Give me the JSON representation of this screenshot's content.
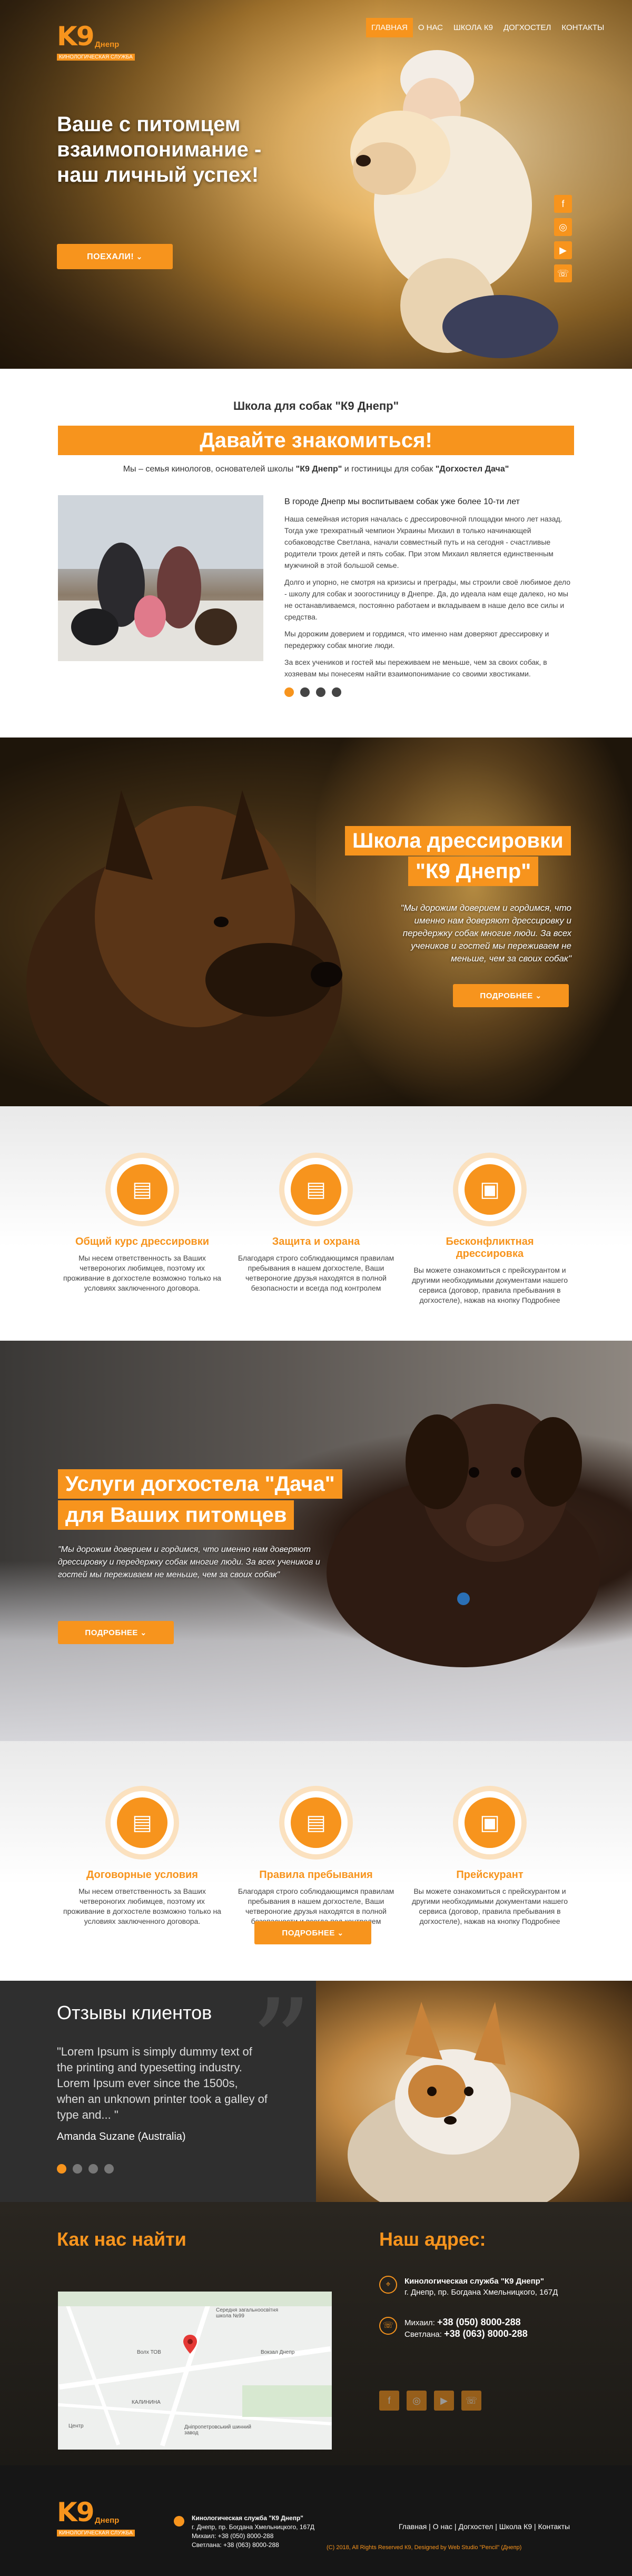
{
  "header": {
    "logo": {
      "mark": "K9",
      "name": "Днепр",
      "sub": "КИНОЛОГИЧЕСКАЯ СЛУЖБА"
    },
    "nav": [
      {
        "label": "Главная",
        "active": true
      },
      {
        "label": "О нас",
        "active": false
      },
      {
        "label": "Школа К9",
        "active": false
      },
      {
        "label": "Догхостел",
        "active": false
      },
      {
        "label": "Контакты",
        "active": false
      }
    ]
  },
  "hero": {
    "title": "Ваше с питомцем взаимопонимание - наш личный успех!",
    "button": "Поехали!",
    "social": [
      "facebook-icon",
      "instagram-icon",
      "youtube-icon",
      "viber-icon"
    ]
  },
  "about": {
    "kicker": "Школа для собак \"К9 Днепр\"",
    "banner": "Давайте знакомиться!",
    "intro_before": "Мы – семья кинологов, основателей школы ",
    "intro_school": "\"К9 Днепр\"",
    "intro_middle": " и гостиницы для собак ",
    "intro_hostel": "\"Догхостел Дача\"",
    "lead": "В городе Днепр мы воспитываем собак уже более 10-ти лет",
    "p1": "Наша семейная история началась с дрессировочной площадки много лет назад. Тогда уже трехкратный чемпион Украины Михаил в только начинающей собаководстве Светлана, начали совместный путь и на сегодня - счастливые родители троих детей и пять собак. При этом Михаил является единственным мужчиной в этой большой семье.",
    "p2": "Долго и упорно, не смотря на кризисы и преграды, мы строили своё любимое дело - школу для собак и зоогостиницу в Днепре. Да, до идеала нам еще далеко, но мы не останавливаемся, постоянно работаем и вкладываем в наше дело все силы и средства.",
    "p3": "Мы дорожим доверием и гордимся, что именно нам доверяют дрессировку и передержку собак многие люди.",
    "p4": "За всех учеников и гостей мы переживаем не меньше, чем за своих собак, в хозяевам мы понесеям найти взаимопонимание со своими хвостиками.",
    "dots": 4,
    "active_dot": 0
  },
  "school": {
    "title_line1": "Школа дрессировки",
    "title_line2": "\"К9 Днепр\"",
    "text": "\"Мы дорожим доверием и гордимся, что именно нам доверяют дрессировку и передержку собак многие люди. За всех учеников и гостей мы переживаем не меньше, чем за своих собак\"",
    "button": "Подробнее"
  },
  "features1": [
    {
      "icon": "document-icon",
      "title": "Общий курс дрессировки",
      "text": "Мы несем ответственность за Ваших четвероногих любимцев, поэтому их проживание в догхостеле возможно только на условиях заключенного договора."
    },
    {
      "icon": "document-icon",
      "title": "Защита и охрана",
      "text": "Благодаря строго соблюдающимся правилам пребывания в нашем догхостеле, Ваши четвероногие друзья находятся в полной безопасности и всегда под контролем"
    },
    {
      "icon": "wallet-icon",
      "title": "Бесконфликтная дрессировка",
      "text": "Вы можете ознакомиться с прейскурантом и другими необходимыми документами нашего сервиса (договор, правила пребывания в догхостеле), нажав на кнопку Подробнее"
    }
  ],
  "dacha": {
    "title_line1": "Услуги догхостела \"Дача\"",
    "title_line2": "для Ваших питомцев",
    "text": "\"Мы дорожим доверием и гордимся, что именно нам доверяют дрессировку и передержку собак многие люди. За всех учеников и гостей мы переживаем не меньше, чем за своих собак\"",
    "button": "Подробнее"
  },
  "features2": [
    {
      "icon": "document-icon",
      "title": "Договорные условия",
      "text": "Мы несем ответственность за Ваших четвероногих любимцев, поэтому их проживание в догхостеле возможно только на условиях заключенного договора."
    },
    {
      "icon": "document-icon",
      "title": "Правила пребывания",
      "text": "Благодаря строго соблюдающимся правилам пребывания в нашем догхостеле, Ваши четвероногие друзья находятся в полной безопасности и всегда под контролем"
    },
    {
      "icon": "wallet-icon",
      "title": "Прейскурант",
      "text": "Вы можете ознакомиться с прейскурантом и другими необходимыми документами нашего сервиса (договор, правила пребывания в догхостеле), нажав на кнопку Подробнее"
    }
  ],
  "features2_button": "Подробнее",
  "reviews": {
    "title": "Отзывы клиентов",
    "quote": "\"Lorem Ipsum is simply dummy text of the printing and typesetting industry. Lorem Ipsum ever since the 1500s, when an unknown printer took a galley of type and... \"",
    "author": "Amanda Suzane (Australia)",
    "dots": 4,
    "active_dot": 0
  },
  "find": {
    "title_left": "Как нас найти",
    "title_right": "Наш адрес:",
    "map_labels": [
      "Середня загальноосвітня школа №99",
      "Вокзал Днепр",
      "Волх ТОВ",
      "КАЛИНИНА",
      "Дніпропетровський шинний завод",
      "Центр"
    ],
    "address_name": "Кинологическая служба \"К9 Днепр\"",
    "address_line": "г. Днепр, пр. Богдана Хмельницкого, 167Д",
    "phone1_name": "Михаил:",
    "phone1": "+38 (050) 8000-288",
    "phone2_name": "Светлана:",
    "phone2": "+38 (063) 8000-288",
    "social": [
      "facebook-icon",
      "instagram-icon",
      "youtube-icon",
      "viber-icon"
    ]
  },
  "footer": {
    "company": "Кинологическая служба \"К9 Днепр\"",
    "address": "г. Днепр, пр. Богдана Хмельницкого, 167Д",
    "phone1": "Михаил: +38 (050) 8000-288",
    "phone2": "Светлана: +38 (063) 8000-288",
    "links": [
      "Главная",
      "О нас",
      "Догхостел",
      "Школа К9",
      "Контакты"
    ],
    "copyright": "(C) 2018, All Rights Reserved К9, Designed by Web Studio \"Pencil\" (Днепр)"
  },
  "colors": {
    "accent": "#f7941d",
    "dark": "#2f2f2f"
  }
}
